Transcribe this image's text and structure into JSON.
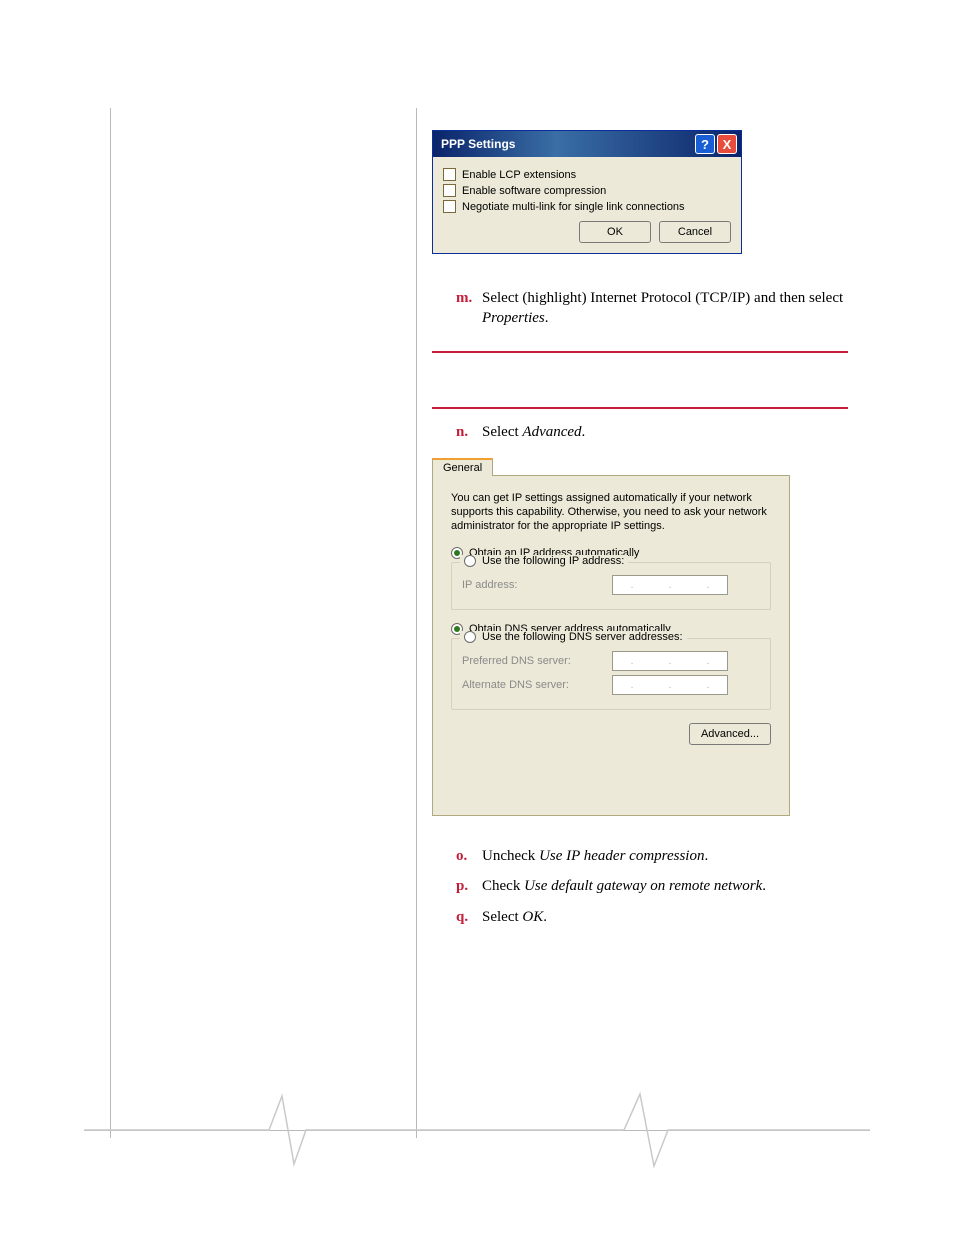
{
  "ppp_dialog": {
    "title": "PPP Settings",
    "help_glyph": "?",
    "close_glyph": "X",
    "checkboxes": [
      {
        "label": "Enable LCP extensions"
      },
      {
        "label": "Enable software compression"
      },
      {
        "label": "Negotiate multi-link for single link connections"
      }
    ],
    "ok_label": "OK",
    "cancel_label": "Cancel"
  },
  "step_m": {
    "letter": "m.",
    "text_pre": "Select (highlight) Internet Protocol (TCP/IP) and then select ",
    "text_em": "Properties",
    "text_post": "."
  },
  "step_n": {
    "letter": "n.",
    "text_pre": "Select ",
    "text_em": "Advanced",
    "text_post": "."
  },
  "tcpip": {
    "tab_label": "General",
    "intro": "You can get IP settings assigned automatically if your network supports this capability. Otherwise, you need to ask your network administrator for the appropriate IP settings.",
    "radio_ip_auto": "Obtain an IP address automatically",
    "radio_ip_manual": "Use the following IP address:",
    "ip_address_label": "IP address:",
    "radio_dns_auto": "Obtain DNS server address automatically",
    "radio_dns_manual": "Use the following DNS server addresses:",
    "preferred_dns_label": "Preferred DNS server:",
    "alternate_dns_label": "Alternate DNS server:",
    "advanced_label": "Advanced...",
    "dot": "."
  },
  "step_o": {
    "letter": "o.",
    "text_pre": "Uncheck ",
    "text_em": "Use IP header compression",
    "text_post": "."
  },
  "step_p": {
    "letter": "p.",
    "text_pre": "Check ",
    "text_em": "Use default gateway on remote network",
    "text_post": "."
  },
  "step_q": {
    "letter": "q.",
    "text_pre": "Select ",
    "text_em": "OK",
    "text_post": "."
  }
}
